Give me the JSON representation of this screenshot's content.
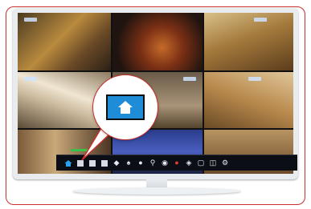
{
  "screen": {
    "title_text": "",
    "tiles": [
      {
        "name": "camera-tile-1",
        "chip": "left"
      },
      {
        "name": "camera-tile-2",
        "chip": "left"
      },
      {
        "name": "camera-tile-3",
        "chip": "left"
      },
      {
        "name": "camera-tile-4",
        "chip": "left"
      },
      {
        "name": "camera-tile-5",
        "chip": "right"
      },
      {
        "name": "camera-tile-6",
        "chip": "right"
      },
      {
        "name": "camera-tile-7",
        "chip": "none"
      },
      {
        "name": "camera-tile-8",
        "chip": "none"
      },
      {
        "name": "camera-tile-9",
        "chip": "none"
      }
    ]
  },
  "toolbar": {
    "icons": [
      "home-icon",
      "layout-1-icon",
      "layout-4-icon",
      "layout-9-icon",
      "layout-16-icon",
      "audio-icon",
      "zoom-icon",
      "search-icon",
      "playback-icon",
      "record-icon",
      "ptz-icon",
      "snapshot-icon",
      "backup-icon",
      "settings-icon"
    ]
  },
  "callout": {
    "icon": "home-icon",
    "highlight_color": "#1e8cd6",
    "outline_color": "#c9302c"
  }
}
